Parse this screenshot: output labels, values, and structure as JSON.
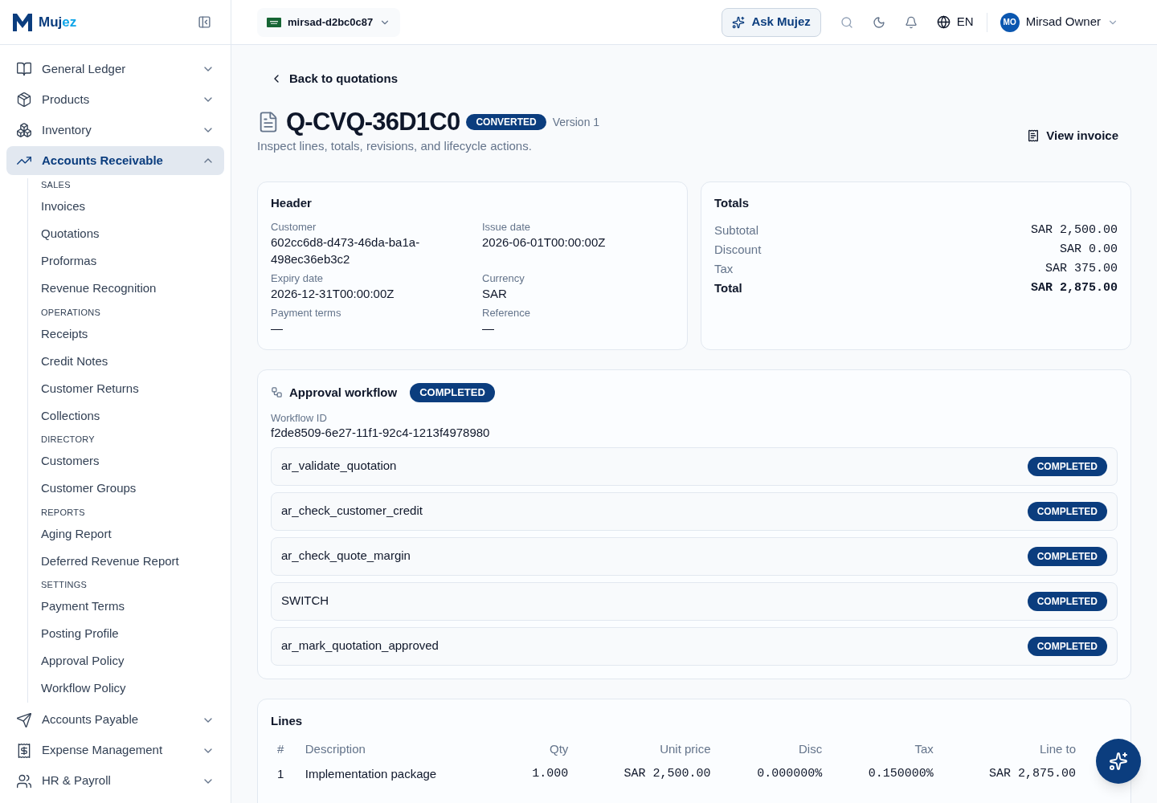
{
  "brand": {
    "name_a": "Muj",
    "name_b": "ez"
  },
  "sidebar": {
    "items": [
      {
        "label": "General Ledger",
        "expanded": false,
        "selected": false
      },
      {
        "label": "Products",
        "expanded": false,
        "selected": false
      },
      {
        "label": "Inventory",
        "expanded": false,
        "selected": false
      },
      {
        "label": "Accounts Receivable",
        "expanded": true,
        "selected": true,
        "groups": [
          {
            "title": "SALES",
            "children": [
              {
                "label": "Invoices",
                "selected": false
              },
              {
                "label": "Quotations",
                "selected": false
              },
              {
                "label": "Proformas",
                "selected": false
              },
              {
                "label": "Revenue Recognition",
                "selected": false
              }
            ]
          },
          {
            "title": "OPERATIONS",
            "children": [
              {
                "label": "Receipts",
                "selected": false
              },
              {
                "label": "Credit Notes",
                "selected": false
              },
              {
                "label": "Customer Returns",
                "selected": false
              },
              {
                "label": "Collections",
                "selected": false
              }
            ]
          },
          {
            "title": "DIRECTORY",
            "children": [
              {
                "label": "Customers",
                "selected": false
              },
              {
                "label": "Customer Groups",
                "selected": false
              }
            ]
          },
          {
            "title": "REPORTS",
            "children": [
              {
                "label": "Aging Report",
                "selected": false
              },
              {
                "label": "Deferred Revenue Report",
                "selected": false
              }
            ]
          },
          {
            "title": "SETTINGS",
            "children": [
              {
                "label": "Payment Terms",
                "selected": false
              },
              {
                "label": "Posting Profile",
                "selected": false
              },
              {
                "label": "Approval Policy",
                "selected": false
              },
              {
                "label": "Workflow Policy",
                "selected": false
              }
            ]
          }
        ]
      },
      {
        "label": "Accounts Payable",
        "expanded": false,
        "selected": false
      },
      {
        "label": "Expense Management",
        "expanded": false,
        "selected": false
      },
      {
        "label": "HR & Payroll",
        "expanded": false,
        "selected": false
      }
    ]
  },
  "topbar": {
    "org": "mirsad-d2bc0c87",
    "ask": "Ask Mujez",
    "language": "EN",
    "avatar": "MO",
    "user": "Mirsad Owner"
  },
  "page": {
    "back": "Back to quotations",
    "title": "Q-CVQ-36D1C0",
    "status": "CONVERTED",
    "version": "Version 1",
    "subtitle": "Inspect lines, totals, revisions, and lifecycle actions.",
    "action": "View invoice"
  },
  "header_card": {
    "title": "Header",
    "fields": [
      {
        "label": "Customer",
        "value": "602cc6d8-d473-46da-ba1a-498ec36eb3c2"
      },
      {
        "label": "Issue date",
        "value": "2026-06-01T00:00:00Z"
      },
      {
        "label": "Expiry date",
        "value": "2026-12-31T00:00:00Z"
      },
      {
        "label": "Currency",
        "value": "SAR"
      },
      {
        "label": "Payment terms",
        "value": "—"
      },
      {
        "label": "Reference",
        "value": "—"
      }
    ]
  },
  "totals_card": {
    "title": "Totals",
    "rows": [
      {
        "label": "Subtotal",
        "value": "SAR 2,500.00",
        "kind": "normal"
      },
      {
        "label": "Discount",
        "value": "SAR 0.00",
        "kind": "normal"
      },
      {
        "label": "Tax",
        "value": "SAR 375.00",
        "kind": "normal"
      },
      {
        "label": "Total",
        "value": "SAR 2,875.00",
        "kind": "grand"
      }
    ]
  },
  "workflow": {
    "title": "Approval workflow",
    "status": "COMPLETED",
    "id_label": "Workflow ID",
    "id": "f2de8509-6e27-11f1-92c4-1213f4978980",
    "steps": [
      {
        "name": "ar_validate_quotation",
        "status": "COMPLETED"
      },
      {
        "name": "ar_check_customer_credit",
        "status": "COMPLETED"
      },
      {
        "name": "ar_check_quote_margin",
        "status": "COMPLETED"
      },
      {
        "name": "SWITCH",
        "status": "COMPLETED"
      },
      {
        "name": "ar_mark_quotation_approved",
        "status": "COMPLETED"
      }
    ]
  },
  "lines": {
    "title": "Lines",
    "columns": [
      "#",
      "Description",
      "Qty",
      "Unit price",
      "Disc",
      "Tax",
      "Line to"
    ],
    "rows": [
      [
        "1",
        "Implementation package",
        "1.000",
        "SAR 2,500.00",
        "0.000000%",
        "0.150000%",
        "SAR 2,875.00"
      ]
    ]
  }
}
